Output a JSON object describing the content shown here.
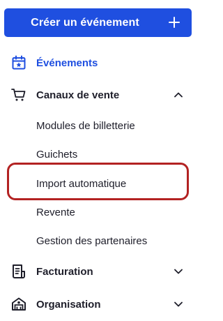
{
  "create_button": {
    "label": "Créer un événement",
    "icon": "plus-icon"
  },
  "nav": {
    "events": {
      "label": "Événements",
      "icon": "calendar-star-icon",
      "active": true
    },
    "sales_channels": {
      "label": "Canaux de vente",
      "icon": "cart-icon",
      "expanded": true,
      "items": [
        {
          "label": "Modules de billetterie"
        },
        {
          "label": "Guichets"
        },
        {
          "label": "Import automatique",
          "highlighted": true
        },
        {
          "label": "Revente"
        },
        {
          "label": "Gestion des partenaires"
        }
      ]
    },
    "billing": {
      "label": "Facturation",
      "icon": "invoice-icon",
      "expanded": false
    },
    "organisation": {
      "label": "Organisation",
      "icon": "building-icon",
      "expanded": false
    }
  },
  "colors": {
    "primary": "#1f4fe0",
    "text": "#1e1e2a",
    "highlight": "#b32222"
  }
}
